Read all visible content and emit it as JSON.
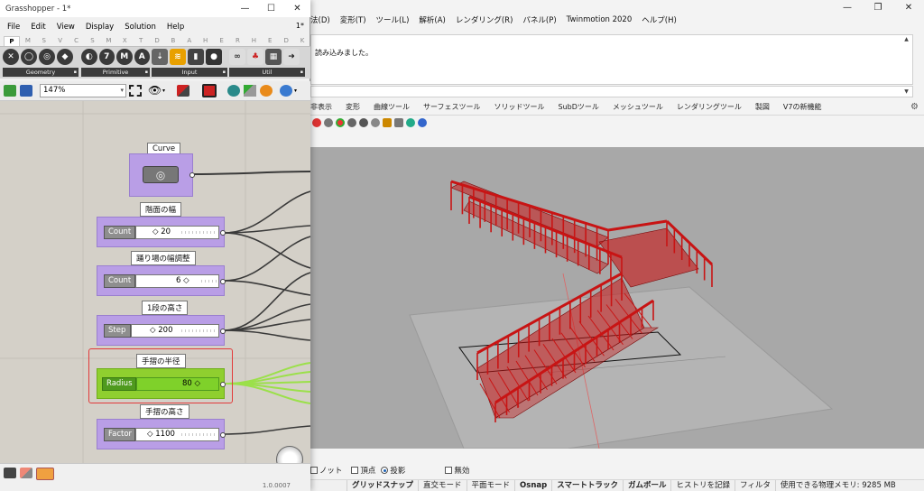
{
  "rhino": {
    "menu": [
      "法(D)",
      "変形(T)",
      "ツール(L)",
      "解析(A)",
      "レンダリング(R)",
      "パネル(P)",
      "Twinmotion 2020",
      "ヘルプ(H)"
    ],
    "command_history": "読み込みました。",
    "tabs": [
      "非表示",
      "変形",
      "曲線ツール",
      "サーフェスツール",
      "ソリッドツール",
      "SubDツール",
      "メッシュツール",
      "レンダリングツール",
      "製図",
      "V7の新機能"
    ],
    "osnap": {
      "items": [
        {
          "label": "ノット",
          "type": "check",
          "checked": false
        },
        {
          "label": "頂点",
          "type": "check",
          "checked": false
        },
        {
          "label": "投影",
          "type": "radio",
          "checked": true
        }
      ],
      "disable_label": "無効"
    },
    "status": [
      {
        "label": "グリッドスナップ",
        "bold": true
      },
      {
        "label": "直交モード",
        "bold": false
      },
      {
        "label": "平面モード",
        "bold": false
      },
      {
        "label": "Osnap",
        "bold": true
      },
      {
        "label": "スマートトラック",
        "bold": true
      },
      {
        "label": "ガムボール",
        "bold": true
      },
      {
        "label": "ヒストリを記録",
        "bold": false
      },
      {
        "label": "フィルタ",
        "bold": false
      },
      {
        "label": "使用できる物理メモリ: 9285 MB",
        "bold": false
      }
    ],
    "stair_color": "#c81414"
  },
  "gh": {
    "title": "Grasshopper - 1*",
    "doc_title": "1*",
    "menu": [
      "File",
      "Edit",
      "View",
      "Display",
      "Solution",
      "Help"
    ],
    "category_tabs": [
      "P",
      "M",
      "S",
      "V",
      "C",
      "S",
      "M",
      "X",
      "T",
      "D",
      "B",
      "A",
      "H",
      "E",
      "R",
      "H",
      "E",
      "D",
      "K"
    ],
    "ribbon_groups": [
      "Geometry",
      "Primitive",
      "Input",
      "Util"
    ],
    "zoom": "147%",
    "version": "1.0.0007",
    "components": {
      "curve": {
        "caption": "Curve"
      },
      "s1": {
        "caption": "階面の幅",
        "name": "Count",
        "value": "20"
      },
      "s2": {
        "caption": "踊り場の幅調整",
        "name": "Count",
        "value": "6"
      },
      "s3": {
        "caption": "1段の高さ",
        "name": "Step",
        "value": "200"
      },
      "s4": {
        "caption": "手摺の半径",
        "name": "Radius",
        "value": "80"
      },
      "s5": {
        "caption": "手摺の高さ",
        "name": "Factor",
        "value": "1100"
      }
    },
    "colors": {
      "group": "#b99ee6",
      "selected": "#8fcf2f",
      "highlight": "#e23a3a"
    }
  }
}
